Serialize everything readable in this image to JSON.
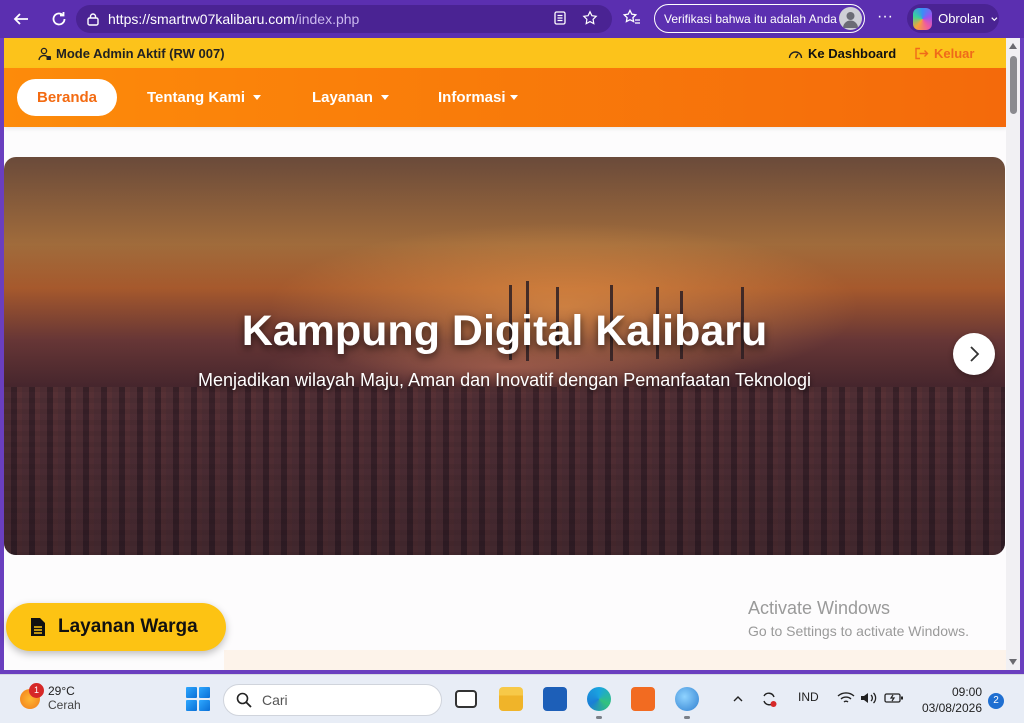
{
  "browser": {
    "url_host": "https://smartrw07kalibaru.com",
    "url_path": "/index.php",
    "verify_text": "Verifikasi bahwa itu adalah Anda",
    "copilot_label": "Obrolan"
  },
  "admin_bar": {
    "mode_text": "Mode Admin Aktif (RW 007)",
    "dashboard_label": "Ke Dashboard",
    "logout_label": "Keluar"
  },
  "nav": {
    "items": [
      {
        "label": "Beranda",
        "active": true
      },
      {
        "label": "Tentang Kami",
        "dropdown": true
      },
      {
        "label": "Layanan",
        "dropdown": true
      },
      {
        "label": "Informasi",
        "dropdown": true
      }
    ]
  },
  "hero": {
    "title": "Kampung Digital Kalibaru",
    "subtitle": "Menjadikan wilayah Maju, Aman dan Inovatif dengan Pemanfaatan Teknologi"
  },
  "floating_button": {
    "label": "Layanan Warga"
  },
  "watermark": {
    "line1": "Activate Windows",
    "line2": "Go to Settings to activate Windows."
  },
  "taskbar": {
    "weather_temp": "29°C",
    "weather_desc": "Cerah",
    "weather_badge": "1",
    "search_placeholder": "Cari",
    "language": "IND",
    "time": "09:00",
    "date": "03/08/2026",
    "notifications": "2"
  },
  "colors": {
    "browser_accent": "#5b2fb0",
    "admin_bar": "#fcc31b",
    "nav_orange": "#f97a0b",
    "nav_active_text": "#f36b12",
    "logout": "#ef6a1a"
  }
}
